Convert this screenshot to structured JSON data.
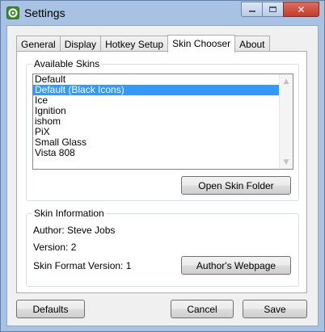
{
  "window": {
    "title": "Settings",
    "caption": {
      "minimize": "—",
      "maximize": "□",
      "close": "✕"
    },
    "accent_frame": "#a7c2e2",
    "close_color": "#c43b2a"
  },
  "tabs": [
    {
      "label": "General",
      "active": false
    },
    {
      "label": "Display",
      "active": false
    },
    {
      "label": "Hotkey Setup",
      "active": false
    },
    {
      "label": "Skin Chooser",
      "active": true
    },
    {
      "label": "About",
      "active": false
    }
  ],
  "available_skins": {
    "legend": "Available Skins",
    "items": [
      "Default",
      "Default (Black Icons)",
      "Ice",
      "Ignition",
      "ishom",
      "PiX",
      "Small Glass",
      "Vista 808"
    ],
    "selected": "Default (Black Icons)",
    "selection_color": "#3399ff",
    "open_folder_button": "Open Skin Folder"
  },
  "skin_information": {
    "legend": "Skin Information",
    "author": "Author: Steve Jobs",
    "version": "Version: 2",
    "format_version": "Skin Format Version: 1",
    "webpage_button": "Author's Webpage"
  },
  "footer": {
    "defaults_button": "Defaults",
    "cancel_button": "Cancel",
    "save_button": "Save"
  }
}
